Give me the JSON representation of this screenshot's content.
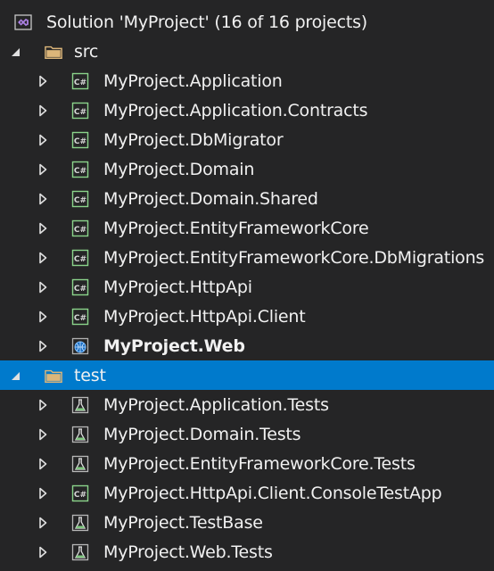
{
  "solution": {
    "label": "Solution 'MyProject' (16 of 16 projects)",
    "icon": "visual-studio-solution-icon"
  },
  "folders": [
    {
      "name": "src",
      "expanded": true,
      "selected": false,
      "projects": [
        {
          "label": "MyProject.Application",
          "icon": "csharp-project-icon",
          "bold": false
        },
        {
          "label": "MyProject.Application.Contracts",
          "icon": "csharp-project-icon",
          "bold": false
        },
        {
          "label": "MyProject.DbMigrator",
          "icon": "csharp-project-icon",
          "bold": false
        },
        {
          "label": "MyProject.Domain",
          "icon": "csharp-project-icon",
          "bold": false
        },
        {
          "label": "MyProject.Domain.Shared",
          "icon": "csharp-project-icon",
          "bold": false
        },
        {
          "label": "MyProject.EntityFrameworkCore",
          "icon": "csharp-project-icon",
          "bold": false
        },
        {
          "label": "MyProject.EntityFrameworkCore.DbMigrations",
          "icon": "csharp-project-icon",
          "bold": false
        },
        {
          "label": "MyProject.HttpApi",
          "icon": "csharp-project-icon",
          "bold": false
        },
        {
          "label": "MyProject.HttpApi.Client",
          "icon": "csharp-project-icon",
          "bold": false
        },
        {
          "label": "MyProject.Web",
          "icon": "web-project-icon",
          "bold": true
        }
      ]
    },
    {
      "name": "test",
      "expanded": true,
      "selected": true,
      "projects": [
        {
          "label": "MyProject.Application.Tests",
          "icon": "test-project-icon",
          "bold": false
        },
        {
          "label": "MyProject.Domain.Tests",
          "icon": "test-project-icon",
          "bold": false
        },
        {
          "label": "MyProject.EntityFrameworkCore.Tests",
          "icon": "test-project-icon",
          "bold": false
        },
        {
          "label": "MyProject.HttpApi.Client.ConsoleTestApp",
          "icon": "csharp-project-icon",
          "bold": false
        },
        {
          "label": "MyProject.TestBase",
          "icon": "test-project-icon",
          "bold": false
        },
        {
          "label": "MyProject.Web.Tests",
          "icon": "test-project-icon",
          "bold": false
        }
      ]
    }
  ],
  "colors": {
    "background": "#252526",
    "selection": "#007acc",
    "text": "#f1f1f1",
    "folder": "#dcb67a",
    "csharp_green": "#8bd48b",
    "test_green": "#7ec77e",
    "vs_purple": "#a97fe0"
  }
}
